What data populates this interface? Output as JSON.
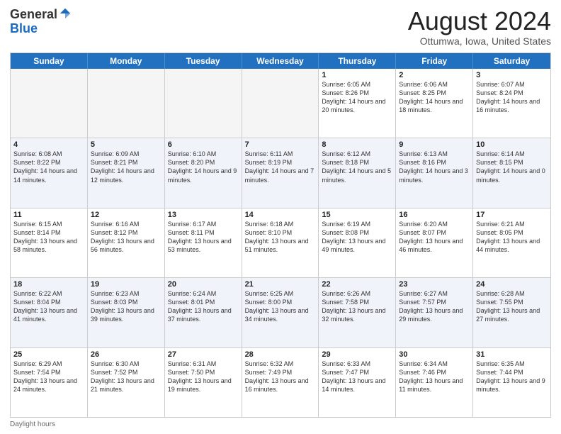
{
  "logo": {
    "general": "General",
    "blue": "Blue"
  },
  "title": "August 2024",
  "subtitle": "Ottumwa, Iowa, United States",
  "days_of_week": [
    "Sunday",
    "Monday",
    "Tuesday",
    "Wednesday",
    "Thursday",
    "Friday",
    "Saturday"
  ],
  "footer": "Daylight hours",
  "weeks": [
    [
      {
        "day": "",
        "sunrise": "",
        "sunset": "",
        "daylight": "",
        "empty": true
      },
      {
        "day": "",
        "sunrise": "",
        "sunset": "",
        "daylight": "",
        "empty": true
      },
      {
        "day": "",
        "sunrise": "",
        "sunset": "",
        "daylight": "",
        "empty": true
      },
      {
        "day": "",
        "sunrise": "",
        "sunset": "",
        "daylight": "",
        "empty": true
      },
      {
        "day": "1",
        "sunrise": "Sunrise: 6:05 AM",
        "sunset": "Sunset: 8:26 PM",
        "daylight": "Daylight: 14 hours and 20 minutes.",
        "empty": false
      },
      {
        "day": "2",
        "sunrise": "Sunrise: 6:06 AM",
        "sunset": "Sunset: 8:25 PM",
        "daylight": "Daylight: 14 hours and 18 minutes.",
        "empty": false
      },
      {
        "day": "3",
        "sunrise": "Sunrise: 6:07 AM",
        "sunset": "Sunset: 8:24 PM",
        "daylight": "Daylight: 14 hours and 16 minutes.",
        "empty": false
      }
    ],
    [
      {
        "day": "4",
        "sunrise": "Sunrise: 6:08 AM",
        "sunset": "Sunset: 8:22 PM",
        "daylight": "Daylight: 14 hours and 14 minutes.",
        "empty": false
      },
      {
        "day": "5",
        "sunrise": "Sunrise: 6:09 AM",
        "sunset": "Sunset: 8:21 PM",
        "daylight": "Daylight: 14 hours and 12 minutes.",
        "empty": false
      },
      {
        "day": "6",
        "sunrise": "Sunrise: 6:10 AM",
        "sunset": "Sunset: 8:20 PM",
        "daylight": "Daylight: 14 hours and 9 minutes.",
        "empty": false
      },
      {
        "day": "7",
        "sunrise": "Sunrise: 6:11 AM",
        "sunset": "Sunset: 8:19 PM",
        "daylight": "Daylight: 14 hours and 7 minutes.",
        "empty": false
      },
      {
        "day": "8",
        "sunrise": "Sunrise: 6:12 AM",
        "sunset": "Sunset: 8:18 PM",
        "daylight": "Daylight: 14 hours and 5 minutes.",
        "empty": false
      },
      {
        "day": "9",
        "sunrise": "Sunrise: 6:13 AM",
        "sunset": "Sunset: 8:16 PM",
        "daylight": "Daylight: 14 hours and 3 minutes.",
        "empty": false
      },
      {
        "day": "10",
        "sunrise": "Sunrise: 6:14 AM",
        "sunset": "Sunset: 8:15 PM",
        "daylight": "Daylight: 14 hours and 0 minutes.",
        "empty": false
      }
    ],
    [
      {
        "day": "11",
        "sunrise": "Sunrise: 6:15 AM",
        "sunset": "Sunset: 8:14 PM",
        "daylight": "Daylight: 13 hours and 58 minutes.",
        "empty": false
      },
      {
        "day": "12",
        "sunrise": "Sunrise: 6:16 AM",
        "sunset": "Sunset: 8:12 PM",
        "daylight": "Daylight: 13 hours and 56 minutes.",
        "empty": false
      },
      {
        "day": "13",
        "sunrise": "Sunrise: 6:17 AM",
        "sunset": "Sunset: 8:11 PM",
        "daylight": "Daylight: 13 hours and 53 minutes.",
        "empty": false
      },
      {
        "day": "14",
        "sunrise": "Sunrise: 6:18 AM",
        "sunset": "Sunset: 8:10 PM",
        "daylight": "Daylight: 13 hours and 51 minutes.",
        "empty": false
      },
      {
        "day": "15",
        "sunrise": "Sunrise: 6:19 AM",
        "sunset": "Sunset: 8:08 PM",
        "daylight": "Daylight: 13 hours and 49 minutes.",
        "empty": false
      },
      {
        "day": "16",
        "sunrise": "Sunrise: 6:20 AM",
        "sunset": "Sunset: 8:07 PM",
        "daylight": "Daylight: 13 hours and 46 minutes.",
        "empty": false
      },
      {
        "day": "17",
        "sunrise": "Sunrise: 6:21 AM",
        "sunset": "Sunset: 8:05 PM",
        "daylight": "Daylight: 13 hours and 44 minutes.",
        "empty": false
      }
    ],
    [
      {
        "day": "18",
        "sunrise": "Sunrise: 6:22 AM",
        "sunset": "Sunset: 8:04 PM",
        "daylight": "Daylight: 13 hours and 41 minutes.",
        "empty": false
      },
      {
        "day": "19",
        "sunrise": "Sunrise: 6:23 AM",
        "sunset": "Sunset: 8:03 PM",
        "daylight": "Daylight: 13 hours and 39 minutes.",
        "empty": false
      },
      {
        "day": "20",
        "sunrise": "Sunrise: 6:24 AM",
        "sunset": "Sunset: 8:01 PM",
        "daylight": "Daylight: 13 hours and 37 minutes.",
        "empty": false
      },
      {
        "day": "21",
        "sunrise": "Sunrise: 6:25 AM",
        "sunset": "Sunset: 8:00 PM",
        "daylight": "Daylight: 13 hours and 34 minutes.",
        "empty": false
      },
      {
        "day": "22",
        "sunrise": "Sunrise: 6:26 AM",
        "sunset": "Sunset: 7:58 PM",
        "daylight": "Daylight: 13 hours and 32 minutes.",
        "empty": false
      },
      {
        "day": "23",
        "sunrise": "Sunrise: 6:27 AM",
        "sunset": "Sunset: 7:57 PM",
        "daylight": "Daylight: 13 hours and 29 minutes.",
        "empty": false
      },
      {
        "day": "24",
        "sunrise": "Sunrise: 6:28 AM",
        "sunset": "Sunset: 7:55 PM",
        "daylight": "Daylight: 13 hours and 27 minutes.",
        "empty": false
      }
    ],
    [
      {
        "day": "25",
        "sunrise": "Sunrise: 6:29 AM",
        "sunset": "Sunset: 7:54 PM",
        "daylight": "Daylight: 13 hours and 24 minutes.",
        "empty": false
      },
      {
        "day": "26",
        "sunrise": "Sunrise: 6:30 AM",
        "sunset": "Sunset: 7:52 PM",
        "daylight": "Daylight: 13 hours and 21 minutes.",
        "empty": false
      },
      {
        "day": "27",
        "sunrise": "Sunrise: 6:31 AM",
        "sunset": "Sunset: 7:50 PM",
        "daylight": "Daylight: 13 hours and 19 minutes.",
        "empty": false
      },
      {
        "day": "28",
        "sunrise": "Sunrise: 6:32 AM",
        "sunset": "Sunset: 7:49 PM",
        "daylight": "Daylight: 13 hours and 16 minutes.",
        "empty": false
      },
      {
        "day": "29",
        "sunrise": "Sunrise: 6:33 AM",
        "sunset": "Sunset: 7:47 PM",
        "daylight": "Daylight: 13 hours and 14 minutes.",
        "empty": false
      },
      {
        "day": "30",
        "sunrise": "Sunrise: 6:34 AM",
        "sunset": "Sunset: 7:46 PM",
        "daylight": "Daylight: 13 hours and 11 minutes.",
        "empty": false
      },
      {
        "day": "31",
        "sunrise": "Sunrise: 6:35 AM",
        "sunset": "Sunset: 7:44 PM",
        "daylight": "Daylight: 13 hours and 9 minutes.",
        "empty": false
      }
    ]
  ]
}
